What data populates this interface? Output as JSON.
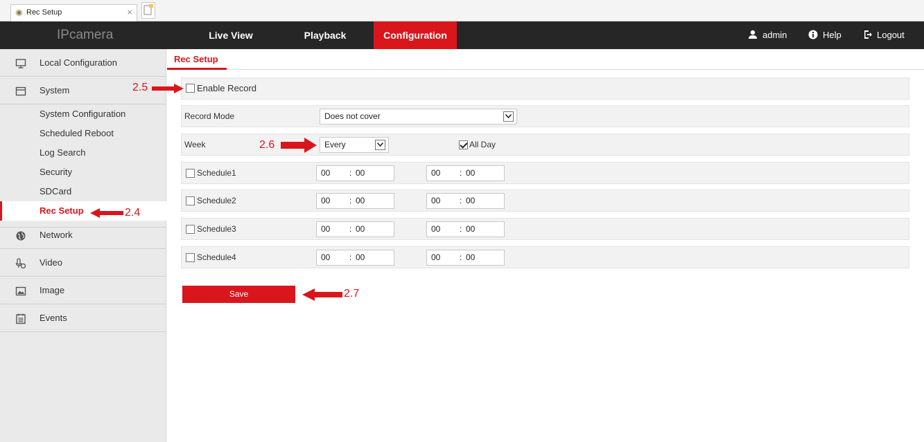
{
  "browser": {
    "tab_title": "Rec Setup",
    "close_glyph": "×"
  },
  "topnav": {
    "brand": "IPcamera",
    "tabs": [
      {
        "label": "Live View",
        "active": false
      },
      {
        "label": "Playback",
        "active": false
      },
      {
        "label": "Configuration",
        "active": true
      }
    ],
    "user": "admin",
    "help": "Help",
    "logout": "Logout"
  },
  "sidebar": {
    "sections": [
      {
        "label": "Local Configuration",
        "icon": "monitor-icon"
      },
      {
        "label": "System",
        "icon": "system-icon"
      },
      {
        "label": "Network",
        "icon": "globe-icon"
      },
      {
        "label": "Video",
        "icon": "video-icon"
      },
      {
        "label": "Image",
        "icon": "image-icon"
      },
      {
        "label": "Events",
        "icon": "events-icon"
      }
    ],
    "system_items": [
      {
        "label": "System Configuration",
        "active": false
      },
      {
        "label": "Scheduled Reboot",
        "active": false
      },
      {
        "label": "Log Search",
        "active": false
      },
      {
        "label": "Security",
        "active": false
      },
      {
        "label": "SDCard",
        "active": false
      },
      {
        "label": "Rec Setup",
        "active": true
      }
    ]
  },
  "main": {
    "title": "Rec Setup",
    "enable_record": {
      "label": "Enable Record",
      "checked": false
    },
    "record_mode": {
      "label": "Record Mode",
      "value": "Does not cover"
    },
    "week": {
      "label": "Week",
      "value": "Every",
      "all_day_label": "All Day",
      "all_day_checked": true
    },
    "schedules": [
      {
        "label": "Schedule1",
        "start_h": "00",
        "start_m": "00",
        "end_h": "00",
        "end_m": "00"
      },
      {
        "label": "Schedule2",
        "start_h": "00",
        "start_m": "00",
        "end_h": "00",
        "end_m": "00"
      },
      {
        "label": "Schedule3",
        "start_h": "00",
        "start_m": "00",
        "end_h": "00",
        "end_m": "00"
      },
      {
        "label": "Schedule4",
        "start_h": "00",
        "start_m": "00",
        "end_h": "00",
        "end_m": "00"
      }
    ],
    "colon": ":",
    "save_label": "Save"
  },
  "annotations": {
    "a24": "2.4",
    "a25": "2.5",
    "a26": "2.6",
    "a27": "2.7"
  },
  "colors": {
    "accent": "#d9161c",
    "nav_bg": "#262626",
    "sidebar_bg": "#eaeaea"
  }
}
